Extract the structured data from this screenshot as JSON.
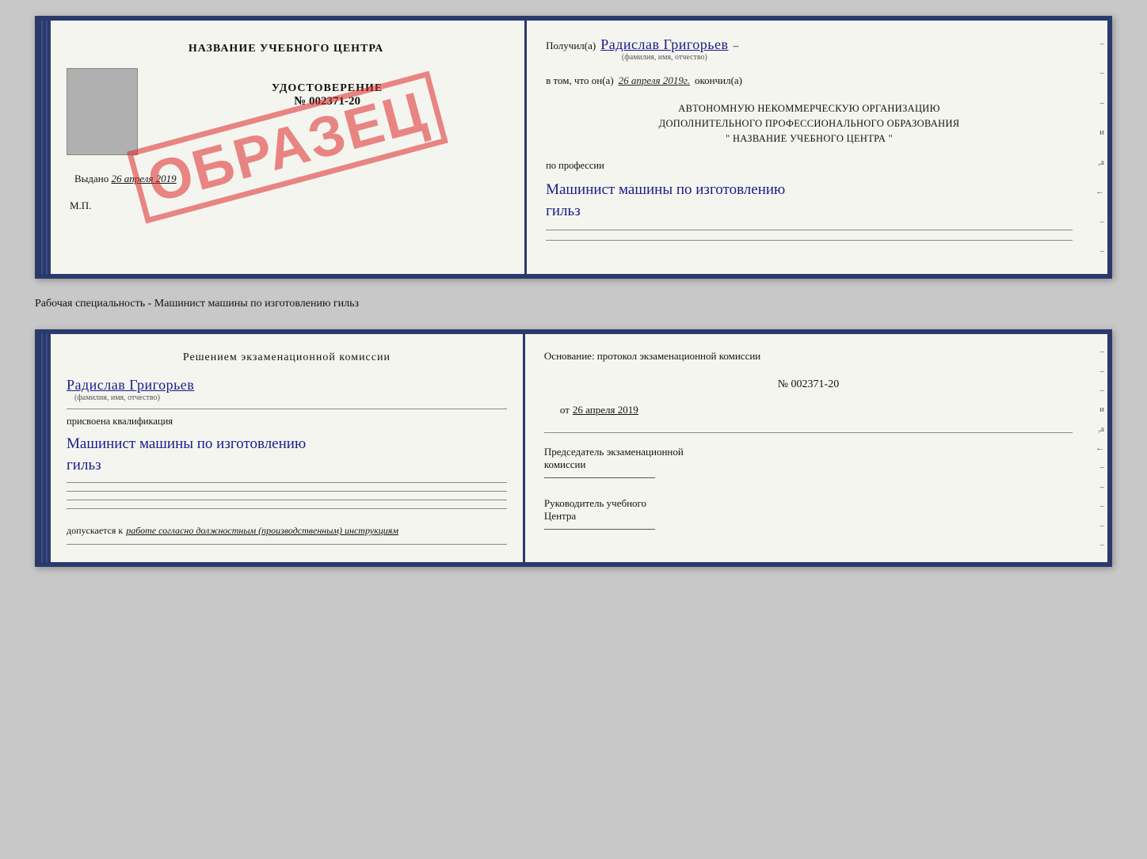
{
  "top_doc": {
    "left": {
      "center_name": "НАЗВАНИЕ УЧЕБНОГО ЦЕНТРА",
      "udostoverenie_title": "УДОСТОВЕРЕНИЕ",
      "udostoverenie_number": "№ 002371-20",
      "vydano_label": "Выдано",
      "vydano_date": "26 апреля 2019",
      "mp_label": "М.П.",
      "stamp_text": "ОБРАЗЕЦ"
    },
    "right": {
      "poluchil_label": "Получил(а)",
      "recipient_name": "Радислав Григорьев",
      "name_hint": "(фамилия, имя, отчество)",
      "vtom_label": "в том, что он(а)",
      "completion_date": "26 апреля 2019г.",
      "okonchil_label": "окончил(а)",
      "org_line1": "АВТОНОМНУЮ НЕКОММЕРЧЕСКУЮ ОРГАНИЗАЦИЮ",
      "org_line2": "ДОПОЛНИТЕЛЬНОГО ПРОФЕССИОНАЛЬНОГО ОБРАЗОВАНИЯ",
      "org_quotes": "\"",
      "org_center_name": "НАЗВАНИЕ УЧЕБНОГО ЦЕНТРА",
      "po_professii_label": "по профессии",
      "profession_line1": "Машинист машины по изготовлению",
      "profession_line2": "гильз"
    }
  },
  "specialty_label": "Рабочая специальность - Машинист машины по изготовлению гильз",
  "bottom_doc": {
    "left": {
      "resheniem_title": "Решением  экзаменационной  комиссии",
      "recipient_name": "Радислав Григорьев",
      "name_hint": "(фамилия, имя, отчество)",
      "prisvoena_label": "присвоена квалификация",
      "qualification_line1": "Машинист машины по изготовлению",
      "qualification_line2": "гильз",
      "dopuskaetsya_label": "допускается к",
      "dopuskaetsya_text": "работе согласно должностным (производственным) инструкциям"
    },
    "right": {
      "osnovanie_label": "Основание: протокол экзаменационной  комиссии",
      "protocol_number": "№  002371-20",
      "ot_label": "от",
      "ot_date": "26 апреля 2019",
      "predsedatel_label": "Председатель экзаменационной",
      "predsedatel_label2": "комиссии",
      "rukovoditel_label": "Руководитель учебного",
      "rukovoditel_label2": "Центра"
    },
    "right_dashes": [
      "-",
      "-",
      "-",
      "и",
      ",а",
      "←",
      "-",
      "-",
      "-",
      "-",
      "-"
    ]
  }
}
